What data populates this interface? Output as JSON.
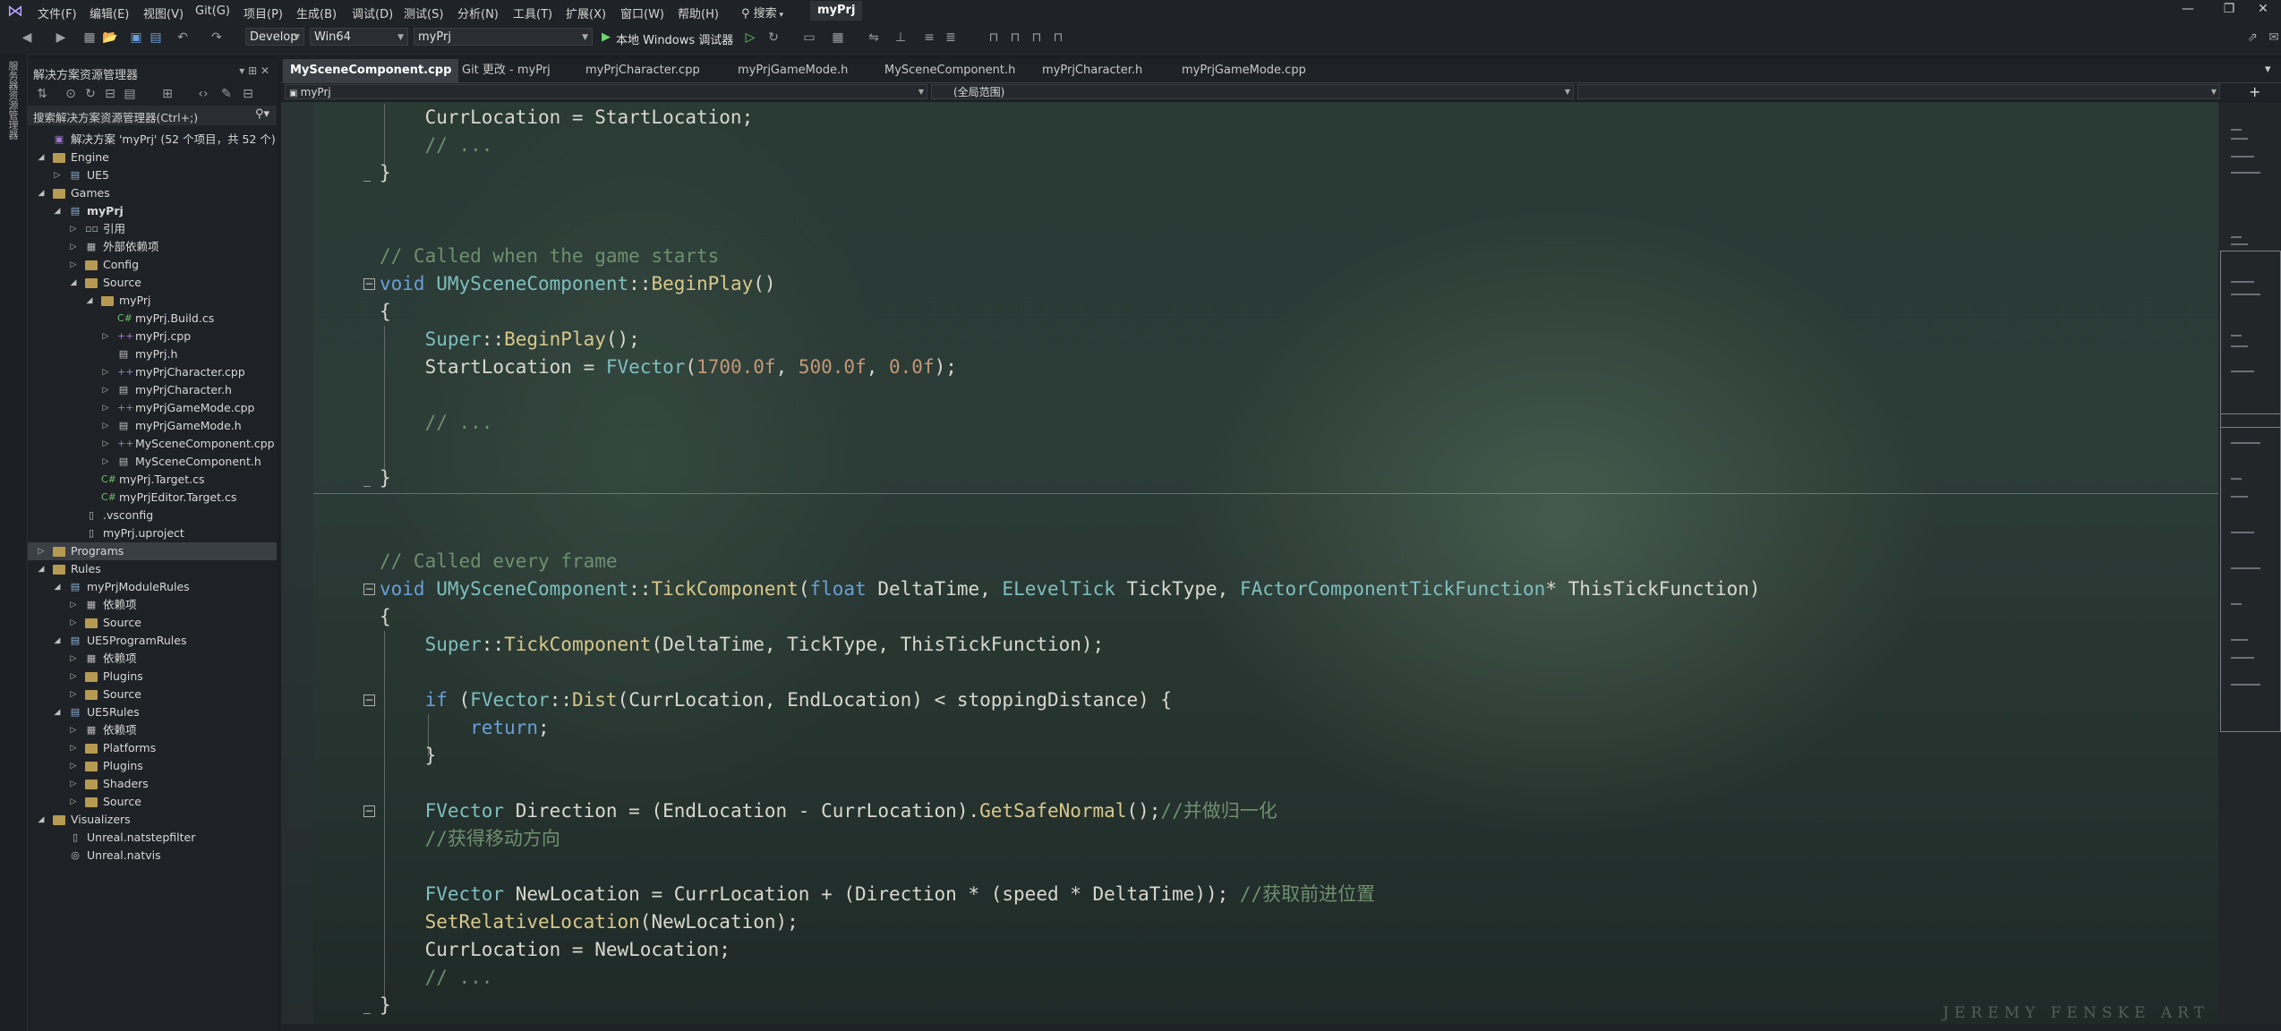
{
  "menu": [
    "文件(F)",
    "编辑(E)",
    "视图(V)",
    "Git(G)",
    "项目(P)",
    "生成(B)",
    "调试(D)",
    "测试(S)",
    "分析(N)",
    "工具(T)",
    "扩展(X)",
    "窗口(W)",
    "帮助(H)"
  ],
  "search_label": "搜索",
  "solution_name_badge": "myPrj",
  "toolbar": {
    "config": "Develop",
    "platform": "Win64",
    "project": "myPrj",
    "run_label": "本地 Windows 调试器"
  },
  "side_strip_label": "服务器资源管理器",
  "solution_explorer": {
    "title": "解决方案资源管理器",
    "search_placeholder": "搜索解决方案资源管理器(Ctrl+;)",
    "items": [
      {
        "label": "解决方案 'myPrj' (52 个项目，共 52 个)",
        "level": 0,
        "arrow": "",
        "icon": "solution"
      },
      {
        "label": "Engine",
        "level": 0,
        "arrow": "open",
        "icon": "folder"
      },
      {
        "label": "UE5",
        "level": 1,
        "arrow": "closed",
        "icon": "project"
      },
      {
        "label": "Games",
        "level": 0,
        "arrow": "open",
        "icon": "folder"
      },
      {
        "label": "myPrj",
        "level": 1,
        "arrow": "open",
        "icon": "project",
        "bold": true
      },
      {
        "label": "引用",
        "level": 2,
        "arrow": "closed",
        "icon": "ref"
      },
      {
        "label": "外部依赖项",
        "level": 2,
        "arrow": "closed",
        "icon": "deps"
      },
      {
        "label": "Config",
        "level": 2,
        "arrow": "closed",
        "icon": "folder"
      },
      {
        "label": "Source",
        "level": 2,
        "arrow": "open",
        "icon": "folder"
      },
      {
        "label": "myPrj",
        "level": 3,
        "arrow": "open",
        "icon": "folder"
      },
      {
        "label": "myPrj.Build.cs",
        "level": 4,
        "arrow": "",
        "icon": "cs"
      },
      {
        "label": "myPrj.cpp",
        "level": 4,
        "arrow": "closed",
        "icon": "cpp"
      },
      {
        "label": "myPrj.h",
        "level": 4,
        "arrow": "",
        "icon": "h"
      },
      {
        "label": "myPrjCharacter.cpp",
        "level": 4,
        "arrow": "closed",
        "icon": "cpp"
      },
      {
        "label": "myPrjCharacter.h",
        "level": 4,
        "arrow": "closed",
        "icon": "h"
      },
      {
        "label": "myPrjGameMode.cpp",
        "level": 4,
        "arrow": "closed",
        "icon": "cpp"
      },
      {
        "label": "myPrjGameMode.h",
        "level": 4,
        "arrow": "closed",
        "icon": "h"
      },
      {
        "label": "MySceneComponent.cpp",
        "level": 4,
        "arrow": "closed",
        "icon": "cpp"
      },
      {
        "label": "MySceneComponent.h",
        "level": 4,
        "arrow": "closed",
        "icon": "h"
      },
      {
        "label": "myPrj.Target.cs",
        "level": 3,
        "arrow": "",
        "icon": "cs"
      },
      {
        "label": "myPrjEditor.Target.cs",
        "level": 3,
        "arrow": "",
        "icon": "cs"
      },
      {
        "label": ".vsconfig",
        "level": 2,
        "arrow": "",
        "icon": "file"
      },
      {
        "label": "myPrj.uproject",
        "level": 2,
        "arrow": "",
        "icon": "file"
      },
      {
        "label": "Programs",
        "level": 0,
        "arrow": "closed",
        "icon": "folder",
        "selected": true
      },
      {
        "label": "Rules",
        "level": 0,
        "arrow": "open",
        "icon": "folder"
      },
      {
        "label": "myPrjModuleRules",
        "level": 1,
        "arrow": "open",
        "icon": "project"
      },
      {
        "label": "依赖项",
        "level": 2,
        "arrow": "closed",
        "icon": "deps"
      },
      {
        "label": "Source",
        "level": 2,
        "arrow": "closed",
        "icon": "folder"
      },
      {
        "label": "UE5ProgramRules",
        "level": 1,
        "arrow": "open",
        "icon": "project"
      },
      {
        "label": "依赖项",
        "level": 2,
        "arrow": "closed",
        "icon": "deps"
      },
      {
        "label": "Plugins",
        "level": 2,
        "arrow": "closed",
        "icon": "folder"
      },
      {
        "label": "Source",
        "level": 2,
        "arrow": "closed",
        "icon": "folder"
      },
      {
        "label": "UE5Rules",
        "level": 1,
        "arrow": "open",
        "icon": "project"
      },
      {
        "label": "依赖项",
        "level": 2,
        "arrow": "closed",
        "icon": "deps"
      },
      {
        "label": "Platforms",
        "level": 2,
        "arrow": "closed",
        "icon": "folder"
      },
      {
        "label": "Plugins",
        "level": 2,
        "arrow": "closed",
        "icon": "folder"
      },
      {
        "label": "Shaders",
        "level": 2,
        "arrow": "closed",
        "icon": "folder"
      },
      {
        "label": "Source",
        "level": 2,
        "arrow": "closed",
        "icon": "folder"
      },
      {
        "label": "Visualizers",
        "level": 0,
        "arrow": "open",
        "icon": "folder"
      },
      {
        "label": "Unreal.natstepfilter",
        "level": 1,
        "arrow": "",
        "icon": "file"
      },
      {
        "label": "Unreal.natvis",
        "level": 1,
        "arrow": "",
        "icon": "natvis"
      }
    ]
  },
  "tabs": [
    "MySceneComponent.cpp",
    "Git 更改 - myPrj",
    "myPrjCharacter.cpp",
    "myPrjGameMode.h",
    "MySceneComponent.h",
    "myPrjCharacter.h",
    "myPrjGameMode.cpp"
  ],
  "nav": {
    "scope": "myPrj",
    "member": "(全局范围)"
  },
  "code_lines": [
    [
      [
        "    CurrLocation = StartLocation;",
        "pl"
      ]
    ],
    [
      [
        "    // ...",
        "cm"
      ]
    ],
    [
      [
        "}",
        "pl"
      ]
    ],
    [],
    [],
    [
      [
        "// Called when the game starts",
        "cm"
      ]
    ],
    [
      [
        "void ",
        "kw"
      ],
      [
        "UMySceneComponent",
        "ty"
      ],
      [
        "::",
        "pl"
      ],
      [
        "BeginPlay",
        "fn"
      ],
      [
        "()",
        "pl"
      ]
    ],
    [
      [
        "{",
        "pl"
      ]
    ],
    [
      [
        "    ",
        "pl"
      ],
      [
        "Super",
        "ty"
      ],
      [
        "::",
        "pl"
      ],
      [
        "BeginPlay",
        "fn"
      ],
      [
        "();",
        "pl"
      ]
    ],
    [
      [
        "    StartLocation = ",
        "pl"
      ],
      [
        "FVector",
        "ty"
      ],
      [
        "(",
        "pl"
      ],
      [
        "1700.0f",
        "nm"
      ],
      [
        ", ",
        "pl"
      ],
      [
        "500.0f",
        "nm"
      ],
      [
        ", ",
        "pl"
      ],
      [
        "0.0f",
        "nm"
      ],
      [
        ");",
        "pl"
      ]
    ],
    [],
    [
      [
        "    // ...",
        "cm"
      ]
    ],
    [],
    [
      [
        "}",
        "pl"
      ]
    ],
    [],
    [],
    [
      [
        "// Called every frame",
        "cm"
      ]
    ],
    [
      [
        "void ",
        "kw"
      ],
      [
        "UMySceneComponent",
        "ty"
      ],
      [
        "::",
        "pl"
      ],
      [
        "TickComponent",
        "fn"
      ],
      [
        "(",
        "pl"
      ],
      [
        "float ",
        "kw"
      ],
      [
        "DeltaTime, ",
        "pl"
      ],
      [
        "ELevelTick ",
        "ty"
      ],
      [
        "TickType, ",
        "pl"
      ],
      [
        "FActorComponentTickFunction",
        "ty"
      ],
      [
        "* ThisTickFunction)",
        "pl"
      ]
    ],
    [
      [
        "{",
        "pl"
      ]
    ],
    [
      [
        "    ",
        "pl"
      ],
      [
        "Super",
        "ty"
      ],
      [
        "::",
        "pl"
      ],
      [
        "TickComponent",
        "fn"
      ],
      [
        "(DeltaTime, TickType, ThisTickFunction);",
        "pl"
      ]
    ],
    [],
    [
      [
        "    ",
        "pl"
      ],
      [
        "if ",
        "kw"
      ],
      [
        "(",
        "pl"
      ],
      [
        "FVector",
        "ty"
      ],
      [
        "::",
        "pl"
      ],
      [
        "Dist",
        "fn"
      ],
      [
        "(CurrLocation, EndLocation) < stoppingDistance) {",
        "pl"
      ]
    ],
    [
      [
        "        ",
        "pl"
      ],
      [
        "return",
        "kw"
      ],
      [
        ";",
        "pl"
      ]
    ],
    [
      [
        "    }",
        "pl"
      ]
    ],
    [],
    [
      [
        "    ",
        "pl"
      ],
      [
        "FVector ",
        "ty"
      ],
      [
        "Direction = (EndLocation - CurrLocation).",
        "pl"
      ],
      [
        "GetSafeNormal",
        "fn"
      ],
      [
        "();",
        "pl"
      ],
      [
        "//并做归一化",
        "cm"
      ]
    ],
    [
      [
        "    //获得移动方向",
        "cm"
      ]
    ],
    [],
    [
      [
        "    ",
        "pl"
      ],
      [
        "FVector ",
        "ty"
      ],
      [
        "NewLocation = CurrLocation + (Direction * (speed * DeltaTime)); ",
        "pl"
      ],
      [
        "//获取前进位置",
        "cm"
      ]
    ],
    [
      [
        "    ",
        "pl"
      ],
      [
        "SetRelativeLocation",
        "fn"
      ],
      [
        "(NewLocation);",
        "pl"
      ]
    ],
    [
      [
        "    CurrLocation = NewLocation;",
        "pl"
      ]
    ],
    [
      [
        "    // ...",
        "cm"
      ]
    ],
    [
      [
        "}",
        "pl"
      ]
    ]
  ],
  "watermark": "JEREMY FENSKE ART"
}
